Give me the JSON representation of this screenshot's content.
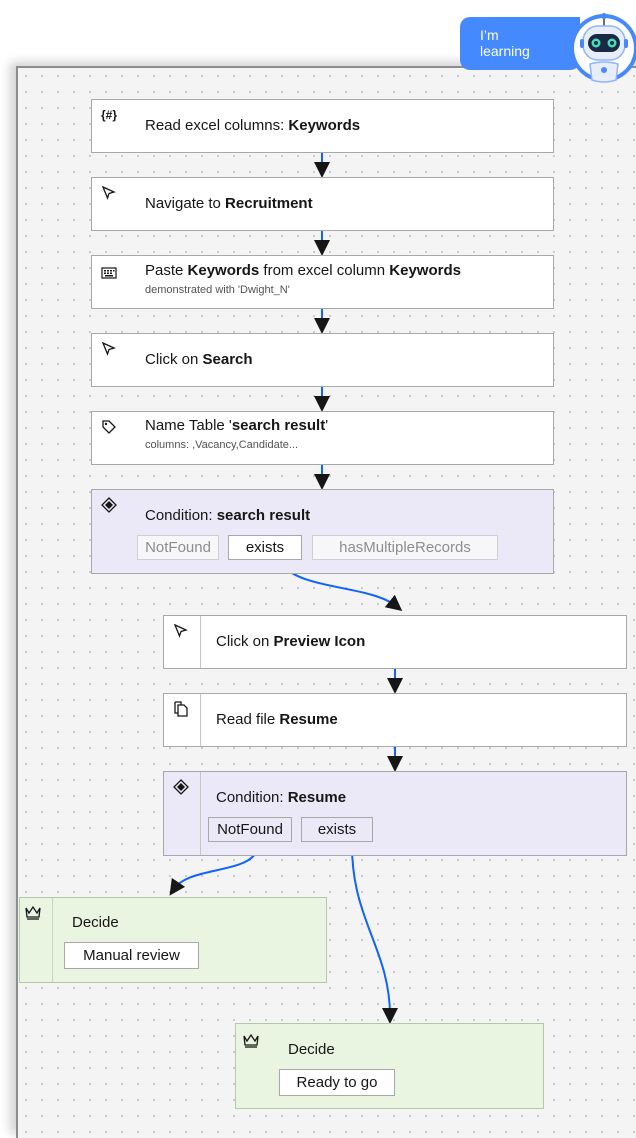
{
  "badge": {
    "line1": "I’m",
    "line2": "learning",
    "color": "#4589ff"
  },
  "colors": {
    "connector": "#0f62fe",
    "condition_bg": "#ebe9f7",
    "decide_bg": "#e9f4e1"
  },
  "steps": [
    {
      "icon": "variable-icon",
      "glyph": "{#}",
      "prefix": "Read excel columns: ",
      "bold": "Keywords"
    },
    {
      "icon": "cursor-icon",
      "glyph": "⇱",
      "prefix": "Navigate to ",
      "bold": "Recruitment"
    },
    {
      "icon": "keyboard-icon",
      "glyph": "⌨",
      "prefix": "Paste ",
      "bold": "Keywords",
      "mid": " from excel column ",
      "bold2": "Keywords",
      "sub": "demonstrated with 'Dwight_N'"
    },
    {
      "icon": "cursor-icon",
      "glyph": "⇱",
      "prefix": "Click on ",
      "bold": "Search"
    },
    {
      "icon": "tag-icon",
      "glyph": "⊳",
      "prefix": "Name Table '",
      "bold": "search result",
      "suffix": "'",
      "sub": "columns: ,Vacancy,Candidate..."
    }
  ],
  "condition1": {
    "icon": "diamond-icon",
    "glyph": "◈",
    "prefix": "Condition: ",
    "bold": "search result",
    "options": [
      "NotFound",
      "exists",
      "hasMultipleRecords"
    ],
    "selected": "exists"
  },
  "branch_steps": [
    {
      "icon": "cursor-icon",
      "glyph": "⇱",
      "prefix": "Click on ",
      "bold": "Preview Icon"
    },
    {
      "icon": "document-icon",
      "glyph": "⎘",
      "prefix": "Read file ",
      "bold": "Resume"
    }
  ],
  "condition2": {
    "icon": "diamond-icon",
    "glyph": "◈",
    "prefix": "Condition: ",
    "bold": "Resume",
    "options": [
      "NotFound",
      "exists"
    ]
  },
  "decide1": {
    "icon": "decision-icon",
    "glyph": "♕",
    "title": "Decide",
    "value": "Manual review"
  },
  "decide2": {
    "icon": "decision-icon",
    "glyph": "♕",
    "title": "Decide",
    "value": "Ready to go"
  }
}
